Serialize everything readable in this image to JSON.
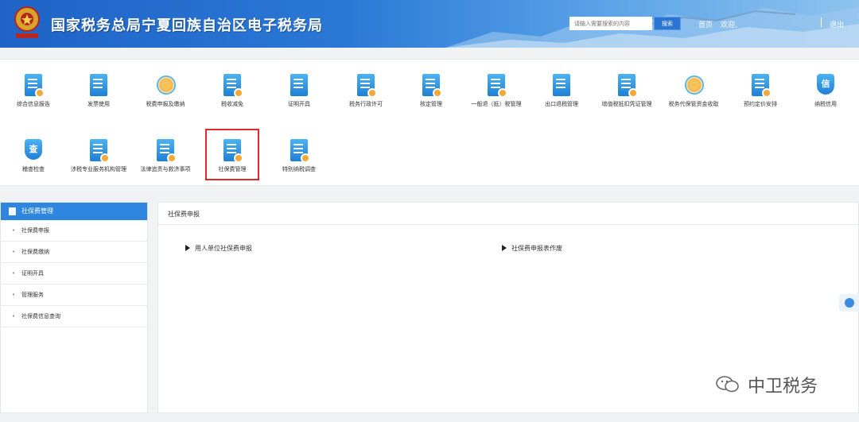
{
  "header": {
    "title": "国家税务总局宁夏回族自治区电子税务局",
    "search_placeholder": "请输入需要搜索的内容",
    "search_button": "搜索",
    "home_link": "首页",
    "welcome": "欢迎,",
    "logout": "退出"
  },
  "icons": [
    {
      "label": "综合信息报告",
      "icon": "report-icon"
    },
    {
      "label": "发票使用",
      "icon": "invoice-icon"
    },
    {
      "label": "税费申报及缴纳",
      "icon": "tax-declare-icon"
    },
    {
      "label": "税收减免",
      "icon": "tax-relief-icon"
    },
    {
      "label": "证明开具",
      "icon": "certificate-icon"
    },
    {
      "label": "税务行政许可",
      "icon": "permit-icon"
    },
    {
      "label": "核定管理",
      "icon": "assessment-icon"
    },
    {
      "label": "一般退（抵）税管理",
      "icon": "refund-icon"
    },
    {
      "label": "出口退税管理",
      "icon": "export-refund-icon"
    },
    {
      "label": "增值税抵扣凭证管理",
      "icon": "vat-voucher-icon"
    },
    {
      "label": "税务代保管资金收取",
      "icon": "custody-fund-icon"
    },
    {
      "label": "预约定价安排",
      "icon": "pricing-icon"
    },
    {
      "label": "纳税信用",
      "icon": "credit-icon",
      "glyph": "信"
    },
    {
      "label": "稽查检查",
      "icon": "inspection-icon",
      "glyph": "查"
    },
    {
      "label": "涉税专业服务机构管理",
      "icon": "agency-icon"
    },
    {
      "label": "法律追责与救济事项",
      "icon": "legal-icon"
    },
    {
      "label": "社保费管理",
      "icon": "social-security-icon"
    },
    {
      "label": "特别纳税调查",
      "icon": "special-investigation-icon"
    }
  ],
  "sidebar": {
    "title": "社保费管理",
    "items": [
      "社保费申报",
      "社保费缴纳",
      "证明开具",
      "管理服务",
      "社保费信息查询"
    ]
  },
  "main": {
    "section_title": "社保费申报",
    "links": [
      "用人单位社保费申报",
      "社保费申报表作废"
    ]
  },
  "watermark": "中卫税务",
  "colors": {
    "accent": "#2f86e0",
    "highlight": "#e22a2a"
  }
}
